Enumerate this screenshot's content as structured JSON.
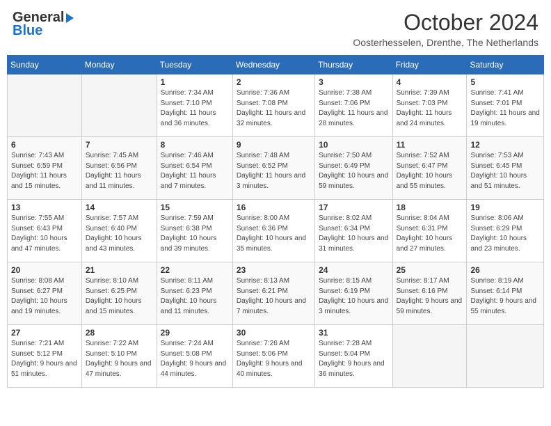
{
  "header": {
    "logo_general": "General",
    "logo_blue": "Blue",
    "month_title": "October 2024",
    "location": "Oosterhesselen, Drenthe, The Netherlands"
  },
  "days_of_week": [
    "Sunday",
    "Monday",
    "Tuesday",
    "Wednesday",
    "Thursday",
    "Friday",
    "Saturday"
  ],
  "weeks": [
    [
      {
        "day": "",
        "info": ""
      },
      {
        "day": "",
        "info": ""
      },
      {
        "day": "1",
        "info": "Sunrise: 7:34 AM\nSunset: 7:10 PM\nDaylight: 11 hours and 36 minutes."
      },
      {
        "day": "2",
        "info": "Sunrise: 7:36 AM\nSunset: 7:08 PM\nDaylight: 11 hours and 32 minutes."
      },
      {
        "day": "3",
        "info": "Sunrise: 7:38 AM\nSunset: 7:06 PM\nDaylight: 11 hours and 28 minutes."
      },
      {
        "day": "4",
        "info": "Sunrise: 7:39 AM\nSunset: 7:03 PM\nDaylight: 11 hours and 24 minutes."
      },
      {
        "day": "5",
        "info": "Sunrise: 7:41 AM\nSunset: 7:01 PM\nDaylight: 11 hours and 19 minutes."
      }
    ],
    [
      {
        "day": "6",
        "info": "Sunrise: 7:43 AM\nSunset: 6:59 PM\nDaylight: 11 hours and 15 minutes."
      },
      {
        "day": "7",
        "info": "Sunrise: 7:45 AM\nSunset: 6:56 PM\nDaylight: 11 hours and 11 minutes."
      },
      {
        "day": "8",
        "info": "Sunrise: 7:46 AM\nSunset: 6:54 PM\nDaylight: 11 hours and 7 minutes."
      },
      {
        "day": "9",
        "info": "Sunrise: 7:48 AM\nSunset: 6:52 PM\nDaylight: 11 hours and 3 minutes."
      },
      {
        "day": "10",
        "info": "Sunrise: 7:50 AM\nSunset: 6:49 PM\nDaylight: 10 hours and 59 minutes."
      },
      {
        "day": "11",
        "info": "Sunrise: 7:52 AM\nSunset: 6:47 PM\nDaylight: 10 hours and 55 minutes."
      },
      {
        "day": "12",
        "info": "Sunrise: 7:53 AM\nSunset: 6:45 PM\nDaylight: 10 hours and 51 minutes."
      }
    ],
    [
      {
        "day": "13",
        "info": "Sunrise: 7:55 AM\nSunset: 6:43 PM\nDaylight: 10 hours and 47 minutes."
      },
      {
        "day": "14",
        "info": "Sunrise: 7:57 AM\nSunset: 6:40 PM\nDaylight: 10 hours and 43 minutes."
      },
      {
        "day": "15",
        "info": "Sunrise: 7:59 AM\nSunset: 6:38 PM\nDaylight: 10 hours and 39 minutes."
      },
      {
        "day": "16",
        "info": "Sunrise: 8:00 AM\nSunset: 6:36 PM\nDaylight: 10 hours and 35 minutes."
      },
      {
        "day": "17",
        "info": "Sunrise: 8:02 AM\nSunset: 6:34 PM\nDaylight: 10 hours and 31 minutes."
      },
      {
        "day": "18",
        "info": "Sunrise: 8:04 AM\nSunset: 6:31 PM\nDaylight: 10 hours and 27 minutes."
      },
      {
        "day": "19",
        "info": "Sunrise: 8:06 AM\nSunset: 6:29 PM\nDaylight: 10 hours and 23 minutes."
      }
    ],
    [
      {
        "day": "20",
        "info": "Sunrise: 8:08 AM\nSunset: 6:27 PM\nDaylight: 10 hours and 19 minutes."
      },
      {
        "day": "21",
        "info": "Sunrise: 8:10 AM\nSunset: 6:25 PM\nDaylight: 10 hours and 15 minutes."
      },
      {
        "day": "22",
        "info": "Sunrise: 8:11 AM\nSunset: 6:23 PM\nDaylight: 10 hours and 11 minutes."
      },
      {
        "day": "23",
        "info": "Sunrise: 8:13 AM\nSunset: 6:21 PM\nDaylight: 10 hours and 7 minutes."
      },
      {
        "day": "24",
        "info": "Sunrise: 8:15 AM\nSunset: 6:19 PM\nDaylight: 10 hours and 3 minutes."
      },
      {
        "day": "25",
        "info": "Sunrise: 8:17 AM\nSunset: 6:16 PM\nDaylight: 9 hours and 59 minutes."
      },
      {
        "day": "26",
        "info": "Sunrise: 8:19 AM\nSunset: 6:14 PM\nDaylight: 9 hours and 55 minutes."
      }
    ],
    [
      {
        "day": "27",
        "info": "Sunrise: 7:21 AM\nSunset: 5:12 PM\nDaylight: 9 hours and 51 minutes."
      },
      {
        "day": "28",
        "info": "Sunrise: 7:22 AM\nSunset: 5:10 PM\nDaylight: 9 hours and 47 minutes."
      },
      {
        "day": "29",
        "info": "Sunrise: 7:24 AM\nSunset: 5:08 PM\nDaylight: 9 hours and 44 minutes."
      },
      {
        "day": "30",
        "info": "Sunrise: 7:26 AM\nSunset: 5:06 PM\nDaylight: 9 hours and 40 minutes."
      },
      {
        "day": "31",
        "info": "Sunrise: 7:28 AM\nSunset: 5:04 PM\nDaylight: 9 hours and 36 minutes."
      },
      {
        "day": "",
        "info": ""
      },
      {
        "day": "",
        "info": ""
      }
    ]
  ]
}
